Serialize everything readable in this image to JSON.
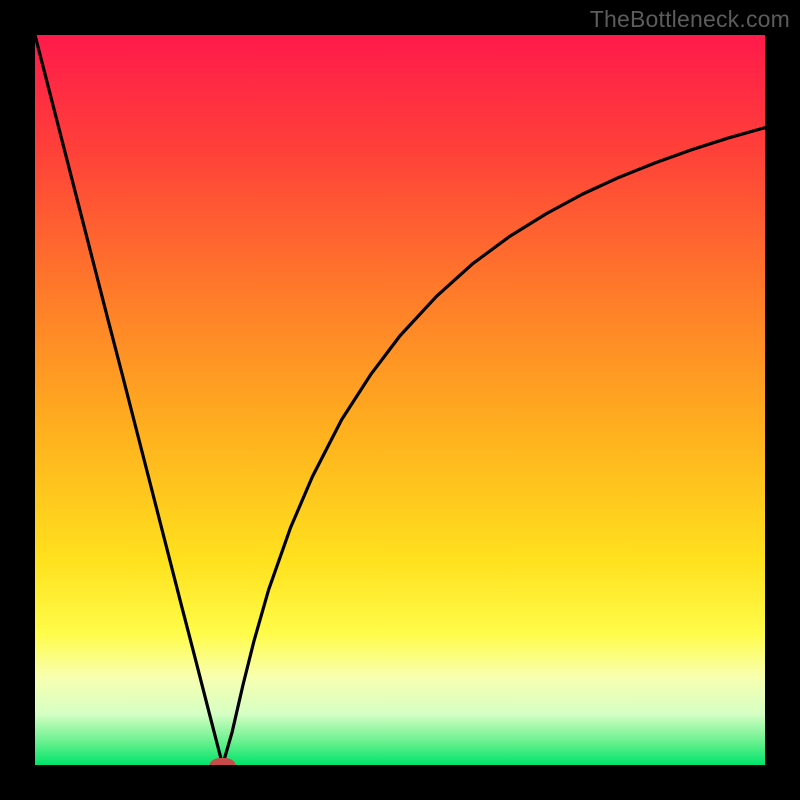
{
  "watermark": "TheBottleneck.com",
  "chart_data": {
    "type": "line",
    "title": "",
    "xlabel": "",
    "ylabel": "",
    "xlim": [
      0,
      100
    ],
    "ylim": [
      0,
      100
    ],
    "gradient_stops": [
      {
        "offset": 0.0,
        "color": "#ff1a4b"
      },
      {
        "offset": 0.15,
        "color": "#ff3e3a"
      },
      {
        "offset": 0.35,
        "color": "#ff7a2a"
      },
      {
        "offset": 0.55,
        "color": "#ffb21e"
      },
      {
        "offset": 0.72,
        "color": "#ffe11e"
      },
      {
        "offset": 0.82,
        "color": "#fffc4a"
      },
      {
        "offset": 0.88,
        "color": "#f8ffb0"
      },
      {
        "offset": 0.93,
        "color": "#d6ffc4"
      },
      {
        "offset": 0.97,
        "color": "#63f08c"
      },
      {
        "offset": 1.0,
        "color": "#00e36b"
      }
    ],
    "series": [
      {
        "name": "curve",
        "x": [
          0.0,
          2.0,
          4.0,
          6.0,
          8.0,
          10.0,
          12.0,
          14.0,
          16.0,
          18.0,
          20.0,
          22.0,
          24.0,
          25.7,
          27.0,
          28.5,
          30.0,
          32.0,
          35.0,
          38.0,
          42.0,
          46.0,
          50.0,
          55.0,
          60.0,
          65.0,
          70.0,
          75.0,
          80.0,
          85.0,
          90.0,
          95.0,
          100.0
        ],
        "y": [
          100.0,
          92.2,
          84.4,
          76.6,
          68.8,
          61.0,
          53.3,
          45.5,
          37.7,
          29.9,
          22.1,
          14.4,
          6.6,
          0.0,
          4.5,
          11.0,
          17.0,
          24.0,
          32.5,
          39.5,
          47.3,
          53.5,
          58.8,
          64.2,
          68.7,
          72.4,
          75.5,
          78.2,
          80.5,
          82.5,
          84.3,
          85.9,
          87.3
        ]
      }
    ],
    "marker": {
      "x": 25.7,
      "y": 0.0,
      "rx": 1.8,
      "ry": 1.0,
      "color": "#c84b4b"
    }
  }
}
